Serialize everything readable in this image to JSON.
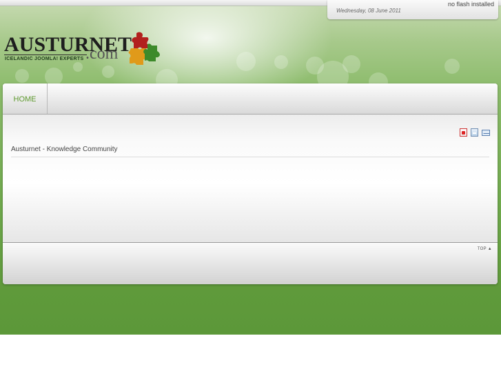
{
  "header": {
    "date": "Wednesday, 08 June 2011",
    "flash_notice": "no flash installed"
  },
  "logo": {
    "name": "AUSTURNET",
    "domain": ".com",
    "tagline": "ICELANDIC JOOMLA! EXPERTS"
  },
  "nav": {
    "items": [
      {
        "label": "HOME"
      }
    ]
  },
  "article": {
    "title": "Austurnet - Knowledge Community",
    "actions": [
      "pdf-icon",
      "print-icon",
      "email-icon"
    ]
  },
  "footer": {
    "top_label": "TOP ▲"
  },
  "colors": {
    "accent_green": "#5f9a2f",
    "background_green": "#6fa94c"
  }
}
